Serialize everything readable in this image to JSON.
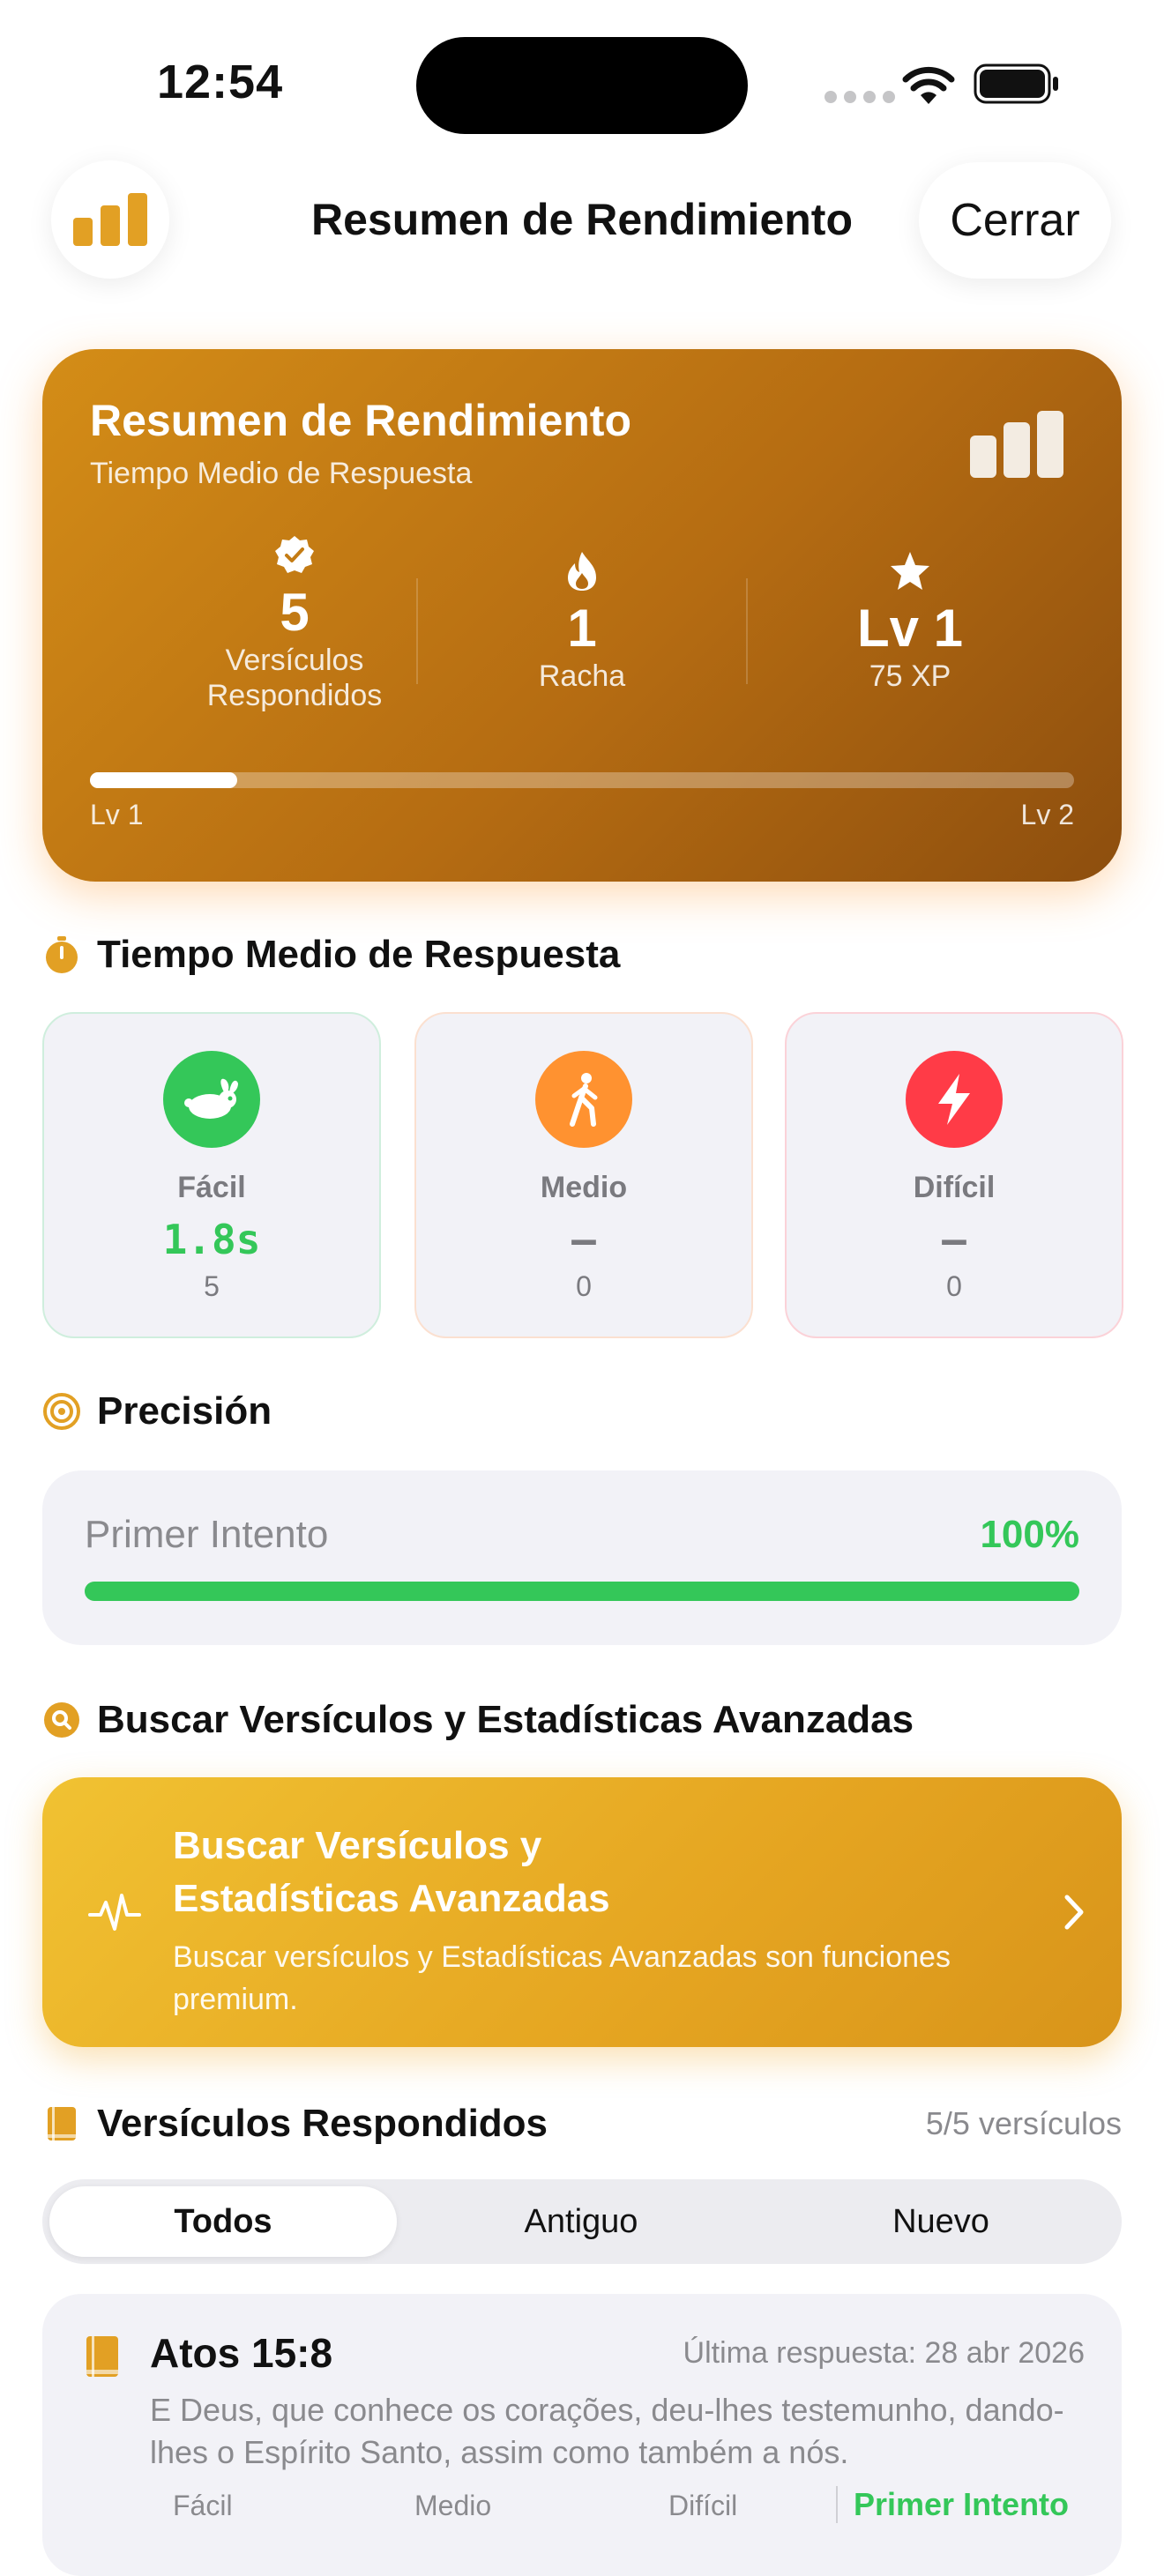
{
  "status_bar": {
    "time": "12:54"
  },
  "nav": {
    "title": "Resumen de Rendimiento",
    "close_label": "Cerrar"
  },
  "summary": {
    "title": "Resumen de Rendimiento",
    "subtitle": "Tiempo Medio de Respuesta",
    "stats": [
      {
        "value": "5",
        "label_line1": "Versículos",
        "label_line2": "Respondidos",
        "icon": "verified-badge-icon"
      },
      {
        "value": "1",
        "label": "Racha",
        "icon": "flame-icon"
      },
      {
        "value": "Lv 1",
        "label": "75 XP",
        "icon": "star-icon"
      }
    ],
    "level_progress": 0.15,
    "level_from": "Lv 1",
    "level_to": "Lv 2",
    "gradient_start": "#d48d17",
    "gradient_end": "#8d4e0e"
  },
  "response_time": {
    "header": "Tiempo Medio de Respuesta",
    "cards": [
      {
        "name": "Fácil",
        "value": "1.8s",
        "count": "5",
        "color": "#34c759",
        "icon": "hare-icon"
      },
      {
        "name": "Medio",
        "value": "—",
        "count": "0",
        "color": "#ff9230",
        "icon": "walking-figure-icon"
      },
      {
        "name": "Difícil",
        "value": "—",
        "count": "0",
        "color": "#ff3b47",
        "icon": "bolt-icon"
      }
    ]
  },
  "precision": {
    "header": "Precisión",
    "label": "Primer Intento",
    "value": "100%",
    "progress": 1.0,
    "color": "#34c759"
  },
  "premium": {
    "header": "Buscar Versículos y Estadísticas Avanzadas",
    "title_line1": "Buscar Versículos y",
    "title_line2": "Estadísticas Avanzadas",
    "description": "Buscar versículos y Estadísticas Avanzadas son funciones premium.",
    "icon": "waveform-pulse-icon"
  },
  "answered": {
    "header": "Versículos Respondidos",
    "count": "5/5 versículos",
    "tabs": [
      {
        "label": "Todos",
        "active": true
      },
      {
        "label": "Antiguo",
        "active": false
      },
      {
        "label": "Nuevo",
        "active": false
      }
    ],
    "verse": {
      "reference": "Atos 15:8",
      "last_answer": "Última respuesta: 28 abr 2026",
      "text": "E Deus, que conhece os corações, deu-lhes testemunho, dando-lhes o Espírito Santo, assim como também a nós.",
      "meta": [
        "Fácil",
        "Medio",
        "Difícil"
      ],
      "first_attempt": "Primer Intento"
    }
  }
}
